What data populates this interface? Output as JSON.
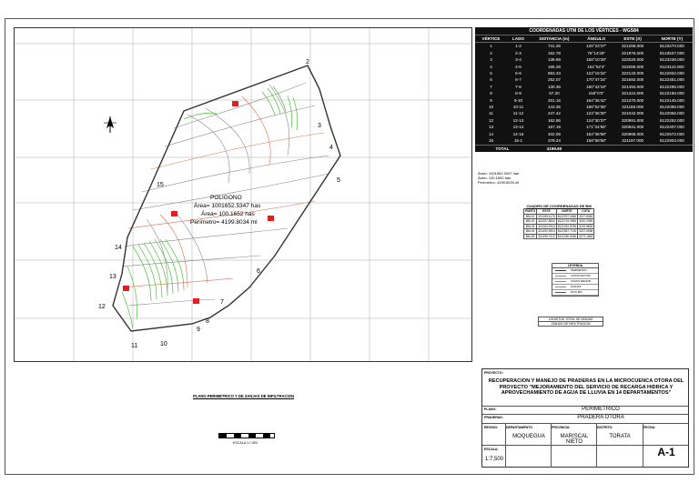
{
  "drawing": {
    "plan_title": "PLANO PERIMETRICO Y DE ZANJAS DE INFILTRACION",
    "scale_bar_label": "ESCALA 1:7,500",
    "polygon_label": {
      "name": "POLIGONO",
      "area_m2": "Área= 1001652.5347 has",
      "area_ha": "Área= 100.1652 has",
      "perimeter": "Perímetro= 4199.8034 ml"
    },
    "vertex_labels": [
      "1",
      "2",
      "3",
      "4",
      "5",
      "6",
      "7",
      "8",
      "9",
      "10",
      "11",
      "12",
      "13",
      "14",
      "15"
    ]
  },
  "coordinates": {
    "title": "COORDENADAS UTM DE LOS VÉRTICES - WGS84",
    "headers": [
      "VÉRTICE",
      "LADO",
      "DISTANCIA (m)",
      "ÁNGULO",
      "ESTE (X)",
      "NORTE (Y)"
    ],
    "rows": [
      [
        "1",
        "1-2",
        "741.26",
        "126°23'37\"",
        "321286.000",
        "8123270.000"
      ],
      [
        "2",
        "2-3",
        "152.78",
        "76°14'28\"",
        "321976.000",
        "8123537.000"
      ],
      [
        "3",
        "3-4",
        "136.69",
        "158°10'29\"",
        "322020.000",
        "8123236.000"
      ],
      [
        "4",
        "4-5",
        "165.28",
        "161°52'4\"",
        "322089.000",
        "8123110.000"
      ],
      [
        "5",
        "5-6",
        "653.43",
        "123°15'34\"",
        "322133.000",
        "8122932.000"
      ],
      [
        "6",
        "6-7",
        "252.07",
        "170°47'24\"",
        "321692.000",
        "8122451.000"
      ],
      [
        "7",
        "7-8",
        "130.36",
        "160°42'18\"",
        "321494.000",
        "8122295.000"
      ],
      [
        "8",
        "8-9",
        "67.20",
        "159°0'0\"",
        "321424.000",
        "8122185.000"
      ],
      [
        "9",
        "9-10",
        "201.16",
        "164°35'42\"",
        "321370.000",
        "8122145.000"
      ],
      [
        "10",
        "10-11",
        "143.35",
        "166°52'35\"",
        "321185.000",
        "8122066.000"
      ],
      [
        "11",
        "11-12",
        "247.42",
        "123°36'30\"",
        "321042.000",
        "8122056.000"
      ],
      [
        "12",
        "12-13",
        "162.86",
        "124°30'37\"",
        "320891.000",
        "8122252.000"
      ],
      [
        "13",
        "13-14",
        "167.19",
        "171°24'55\"",
        "320941.000",
        "8122407.000"
      ],
      [
        "14",
        "14-15",
        "402.09",
        "154°36'58\"",
        "320968.000",
        "8122572.000"
      ],
      [
        "15",
        "15-1",
        "378.24",
        "158°58'58\"",
        "321197.000",
        "8122903.000"
      ]
    ],
    "total_label": "TOTAL",
    "total_value": "4199.80"
  },
  "area_notes": [
    "Área= 1001652.5347 has",
    "Área= 100.1652 has",
    "Perímetro= 4199.8034 ml"
  ],
  "cuadro": {
    "title": "CUADRO DE COORDENADAS DE BM",
    "headers": [
      "PUNTO",
      "ESTE",
      "NORTE",
      "COTA"
    ],
    "rows": [
      [
        "BM-01",
        "321289.4176",
        "8122937.2660",
        "3227.6046"
      ],
      [
        "BM-02",
        "321357.8832",
        "8122719.3960",
        "3220.2390"
      ],
      [
        "BM-03",
        "321363.0944",
        "8122491.8780",
        "3232.8826"
      ],
      [
        "BM-04",
        "321492.5904",
        "8122567.7130",
        "3237.6936"
      ],
      [
        "BM-05",
        "321395.7410",
        "8122250.0460",
        "3272.1845"
      ]
    ]
  },
  "legend": {
    "title": "LEYENDA",
    "items": [
      "PERIMETRO",
      "CURVA MAYOR",
      "CURVA MENOR",
      "ZANJAS",
      "HITO BM"
    ]
  },
  "total_zanjas": {
    "label": "LONGITUD TOTAL DE ZANJAS",
    "value": "ZANJAS DE INFILTRACION"
  },
  "title_block": {
    "proyecto_label": "PROYECTO:",
    "proyecto": "RECUPERACION Y MANEJO DE PRADERAS EN LA MICROCUENCA OTORA DEL PROYECTO \"MEJORAMIENTO DEL SERVICIO DE RECARGA HIDRICA Y APROVECHAMIENTO DE AGUA DE LLUVIA EN 14 DEPARTAMENTOS\"",
    "plano_label": "PLANO:",
    "plano": "PERIMETRICO",
    "praderas_label": "PRADERAS:",
    "pradera": "PRADERA OTORA",
    "region_label": "REGION:",
    "departamento_label": "DEPARTAMENTO",
    "provincia_label": "PROVINCIA:",
    "distrito_label": "DISTRITO:",
    "fecha_label": "FECHA:",
    "departamento": "MOQUEGUA",
    "provincia": "MARISCAL NIETO",
    "distrito": "TORATA",
    "escala_label": "ESCALA:",
    "escala": "1:7,500",
    "sheet": "A-1"
  }
}
